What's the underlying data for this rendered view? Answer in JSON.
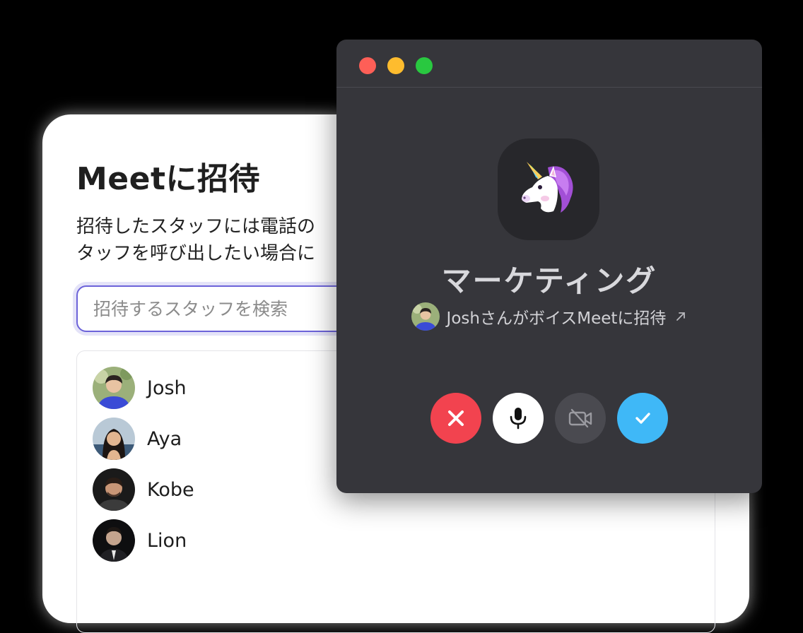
{
  "invite_panel": {
    "title": "Meetに招待",
    "description_lines": [
      "招待したスタッフには電話の",
      "タッフを呼び出したい場合に"
    ],
    "search_placeholder": "招待するスタッフを検索",
    "staff": [
      {
        "name": "Josh"
      },
      {
        "name": "Aya"
      },
      {
        "name": "Kobe"
      },
      {
        "name": "Lion"
      }
    ]
  },
  "call_window": {
    "group_name": "マーケティング",
    "group_icon": "unicorn-emoji",
    "invite_text": "JoshさんがボイスMeetに招待",
    "controls": [
      {
        "name": "decline",
        "icon": "close-icon",
        "color": "#f2434f"
      },
      {
        "name": "mic",
        "icon": "microphone-icon",
        "color": "#ffffff"
      },
      {
        "name": "video",
        "icon": "video-off-icon",
        "color": "#4a4a50"
      },
      {
        "name": "accept",
        "icon": "check-icon",
        "color": "#3fb8f7"
      }
    ]
  },
  "colors": {
    "accent_purple": "#6c63d9",
    "window_bg": "#36363b",
    "traffic_red": "#fe5f57",
    "traffic_yellow": "#febc2e",
    "traffic_green": "#29c840"
  }
}
